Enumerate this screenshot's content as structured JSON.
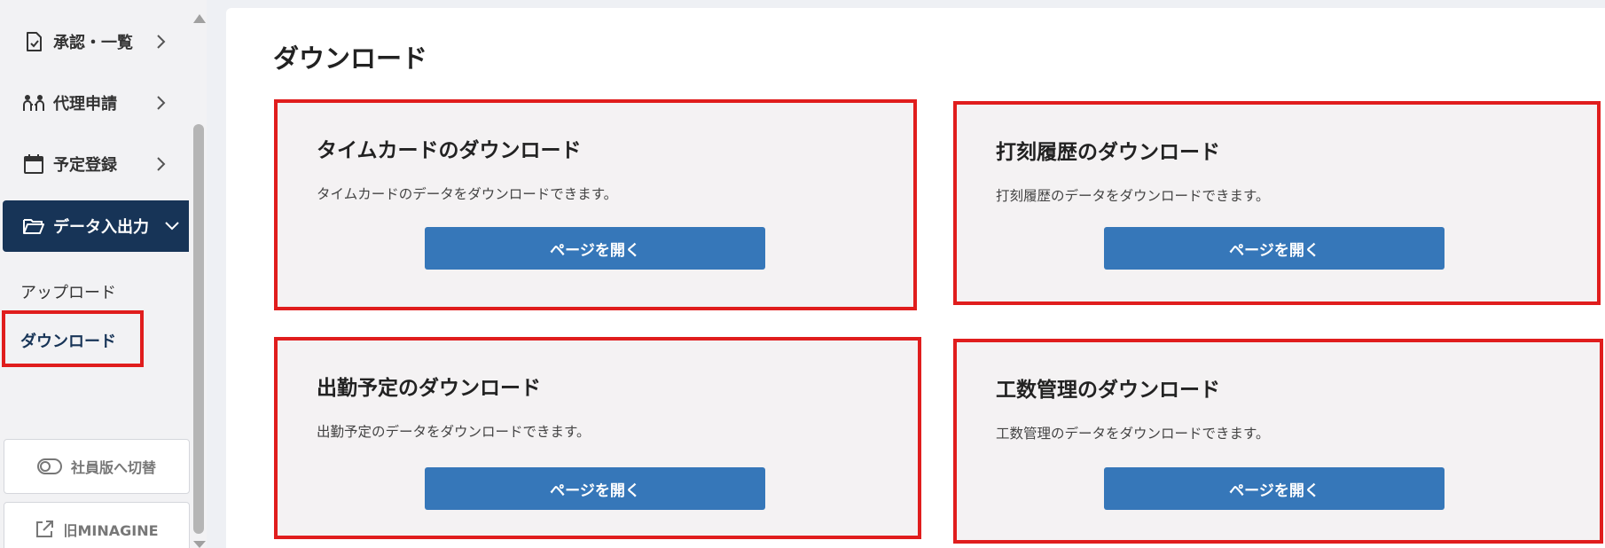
{
  "sidebar": {
    "items": [
      {
        "label": "承認・一覧",
        "icon": "document-check-icon"
      },
      {
        "label": "代理申請",
        "icon": "people-icon"
      },
      {
        "label": "予定登録",
        "icon": "calendar-icon"
      },
      {
        "label": "データ入出力",
        "icon": "folder-open-icon"
      }
    ],
    "sub_items": [
      {
        "label": "アップロード"
      },
      {
        "label": "ダウンロード"
      }
    ],
    "switch_button": "社員版へ切替",
    "old_link": "旧MINAGINE"
  },
  "main": {
    "title": "ダウンロード",
    "cards": [
      {
        "title": "タイムカードのダウンロード",
        "description": "タイムカードのデータをダウンロードできます。",
        "button": "ページを開く"
      },
      {
        "title": "打刻履歴のダウンロード",
        "description": "打刻履歴のデータをダウンロードできます。",
        "button": "ページを開く"
      },
      {
        "title": "出勤予定のダウンロード",
        "description": "出勤予定のデータをダウンロードできます。",
        "button": "ページを開く"
      },
      {
        "title": "工数管理のダウンロード",
        "description": "工数管理のデータをダウンロードできます。",
        "button": "ページを開く"
      }
    ]
  },
  "colors": {
    "active_nav_bg": "#173457",
    "button_blue": "#3677b9",
    "highlight_red": "#e01d1d",
    "card_bg": "#f4f2f3"
  }
}
